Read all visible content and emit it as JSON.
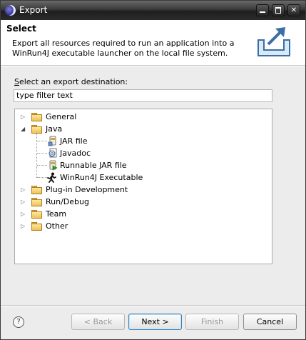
{
  "window": {
    "title": "Export"
  },
  "header": {
    "title": "Select",
    "description": "Export all resources required to run an application into a WinRun4J executable launcher on the local file system."
  },
  "destination": {
    "label_prefix": "S",
    "label_rest": "elect an export destination:",
    "filter_value": "type filter text"
  },
  "tree": {
    "items": [
      {
        "label": "General",
        "kind": "folder",
        "expanded": false
      },
      {
        "label": "Java",
        "kind": "folder",
        "expanded": true
      },
      {
        "label": "JAR file",
        "kind": "jar"
      },
      {
        "label": "Javadoc",
        "kind": "javadoc"
      },
      {
        "label": "Runnable JAR file",
        "kind": "runnable-jar"
      },
      {
        "label": "WinRun4J Executable",
        "kind": "winrun4j"
      },
      {
        "label": "Plug-in Development",
        "kind": "folder",
        "expanded": false
      },
      {
        "label": "Run/Debug",
        "kind": "folder",
        "expanded": false
      },
      {
        "label": "Team",
        "kind": "folder",
        "expanded": false
      },
      {
        "label": "Other",
        "kind": "folder",
        "expanded": false
      }
    ]
  },
  "buttons": {
    "help": "?",
    "back": "< Back",
    "next": "Next >",
    "finish": "Finish",
    "cancel": "Cancel"
  },
  "icons": {
    "app": "eclipse-icon",
    "banner": "export-tray-icon",
    "collapsed": "▷",
    "expanded": "◢"
  }
}
